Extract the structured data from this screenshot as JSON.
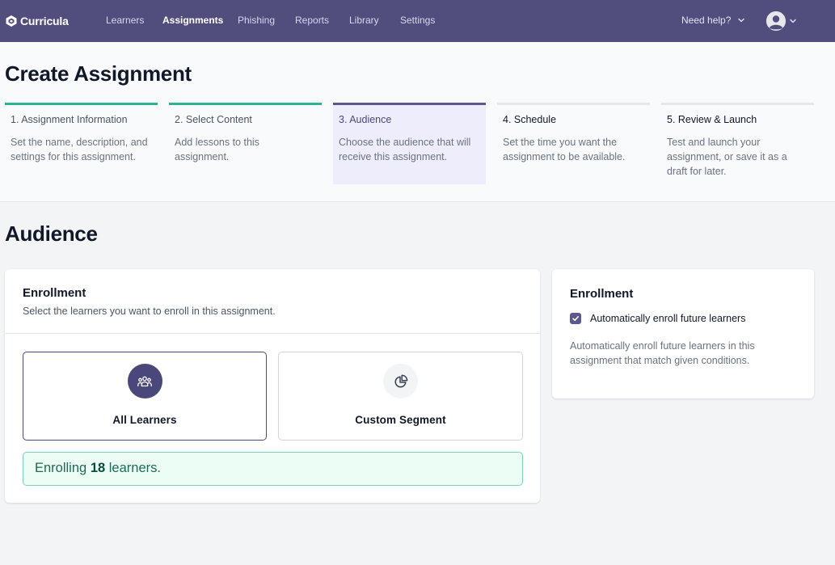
{
  "nav": {
    "logo_text": "Curricula",
    "items": [
      {
        "label": "Learners",
        "active": false
      },
      {
        "label": "Assignments",
        "active": true
      },
      {
        "label": "Phishing",
        "active": false
      },
      {
        "label": "Reports",
        "active": false
      },
      {
        "label": "Library",
        "active": false
      },
      {
        "label": "Settings",
        "active": false
      }
    ],
    "help_label": "Need help?",
    "account_icon": "user-avatar-icon"
  },
  "page_title": "Create Assignment",
  "steps": [
    {
      "title": "1. Assignment Information",
      "description": "Set the name, description, and settings for this assignment.",
      "state": "done"
    },
    {
      "title": "2. Select Content",
      "description": "Add lessons to this assignment.",
      "state": "done"
    },
    {
      "title": "3. Audience",
      "description": "Choose the audience that will receive this assignment.",
      "state": "current"
    },
    {
      "title": "4. Schedule",
      "description": "Set the time you want the assignment to be available.",
      "state": "upcoming"
    },
    {
      "title": "5. Review & Launch",
      "description": "Test and launch your assignment, or save it as a draft for later.",
      "state": "upcoming"
    }
  ],
  "section_title": "Audience",
  "enrollment_card": {
    "title": "Enrollment",
    "subtitle": "Select the learners you want to enroll in this assignment.",
    "options": [
      {
        "label": "All Learners",
        "icon": "users-group-icon",
        "selected": true
      },
      {
        "label": "Custom Segment",
        "icon": "pie-chart-icon",
        "selected": false
      }
    ],
    "enroll_prefix": "Enrolling",
    "enroll_count": "18",
    "enroll_suffix": "learners."
  },
  "side_card": {
    "title": "Enrollment",
    "checkbox_label": "Automatically enroll future learners",
    "checkbox_checked": true,
    "description": "Automatically enroll future learners in this assignment that match given conditions."
  },
  "colors": {
    "nav_bg": "#514e7e",
    "accent": "#4a477a",
    "step_done": "#2bb492",
    "step_current": "#5b588e",
    "success_bg": "#ecfdf5",
    "success_border": "#7dd3b6"
  }
}
